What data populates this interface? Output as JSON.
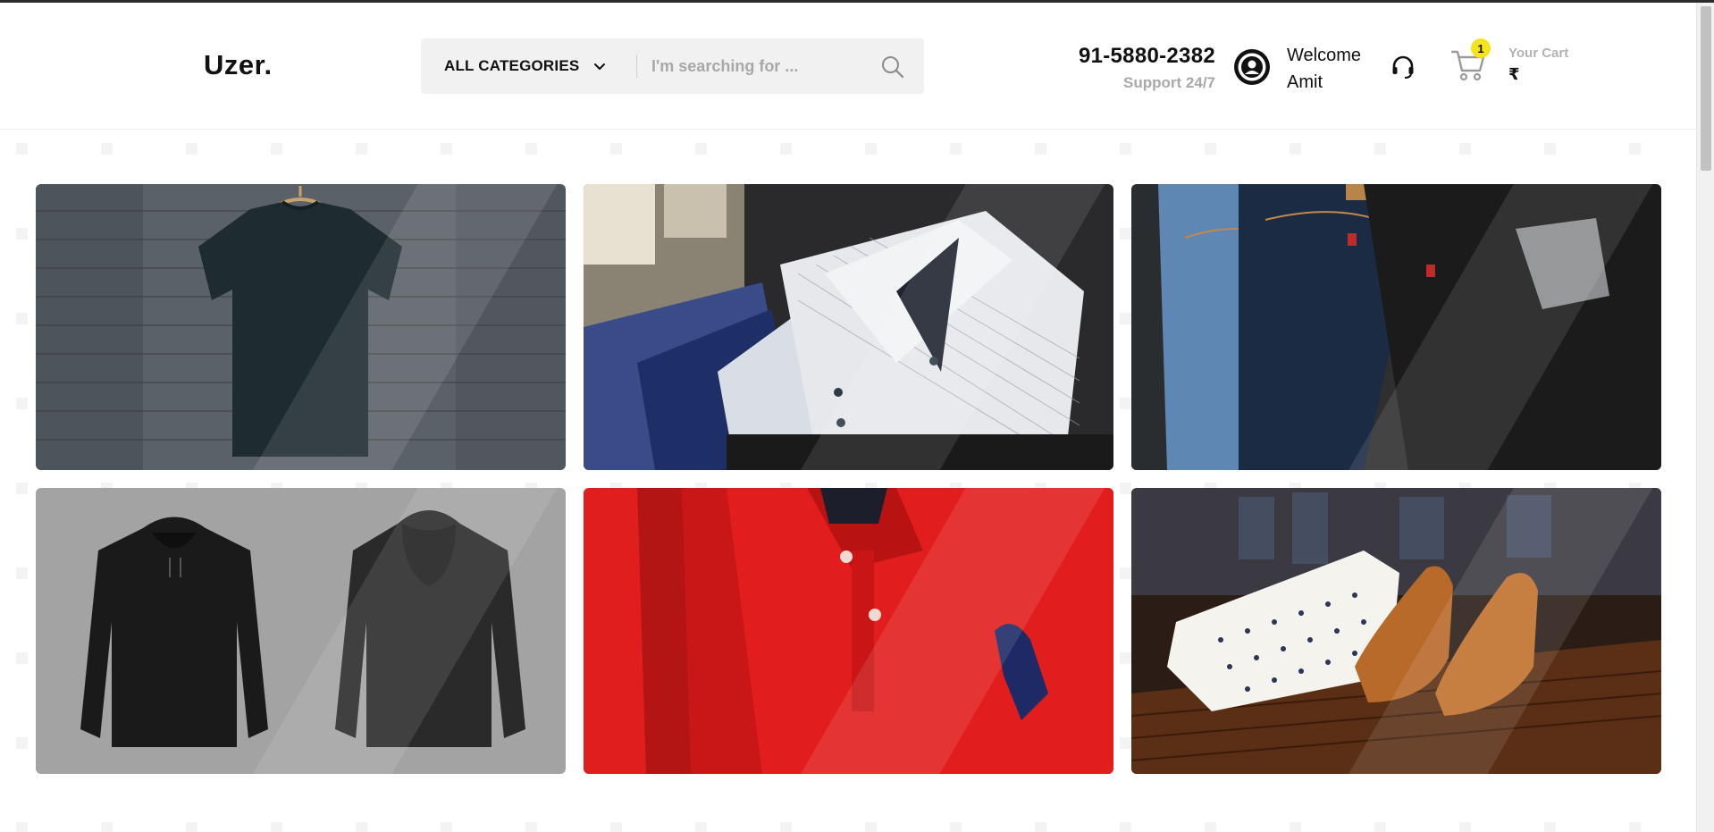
{
  "header": {
    "logo": "Uzer.",
    "category_label": "ALL CATEGORIES",
    "search_placeholder": "I'm searching for ...",
    "phone": "91-5880-2382",
    "support": "Support 24/7",
    "welcome_line1": "Welcome",
    "welcome_line2": "Amit",
    "cart_count": "1",
    "cart_label": "Your Cart",
    "cart_amount": "₹"
  },
  "icons": {
    "category": "chevron-down-icon",
    "search": "search-icon",
    "avatar": "user-avatar-icon",
    "support": "headset-icon",
    "cart": "shopping-cart-icon"
  },
  "tiles": [
    {
      "subject": "t-shirt"
    },
    {
      "subject": "shirt"
    },
    {
      "subject": "jeans"
    },
    {
      "subject": "hoodie"
    },
    {
      "subject": "polo"
    },
    {
      "subject": "formal-wear"
    }
  ],
  "colors": {
    "badge": "#f4e51b",
    "muted_text": "#a9a9a9",
    "search_bg": "#f1f1f1"
  }
}
